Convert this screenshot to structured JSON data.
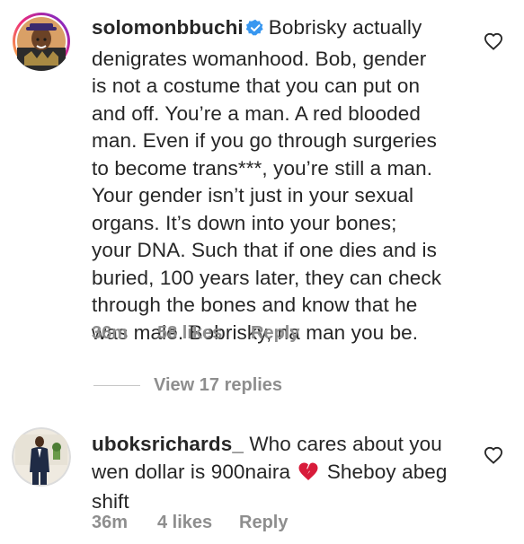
{
  "comments": [
    {
      "username": "solomonbbuchi",
      "verified": true,
      "text_lines": [
        "Bobrisky actually",
        "denigrates womanhood. Bob, gender",
        "is not a costume that you can put on",
        "and off. You’re a man. A red blooded",
        "man. Even if you go through surgeries",
        "to become trans***, you’re still a man.",
        "Your gender isn’t just in your sexual",
        "organs. It’s down into your bones;",
        "your DNA. Such that if one dies and is",
        "buried, 100 years later, they can check",
        "through the bones and know that he",
        "was male. Bobrisky, na man you be."
      ],
      "time": "36m",
      "likes": "58 likes",
      "reply_label": "Reply"
    },
    {
      "username": "uboksrichards_",
      "verified": false,
      "text_line1": "Who cares about you",
      "text_line2a": "wen dollar is 900naira",
      "emoji": "broken-heart-icon",
      "text_line2b": "Sheboy abeg",
      "text_line3": "shift",
      "time": "36m",
      "likes": "4 likes",
      "reply_label": "Reply"
    }
  ],
  "view_replies": "View 17 replies",
  "colors": {
    "text": "#262626",
    "meta": "#8e8e8e",
    "verified_blue": "#3897f0",
    "broken_heart": "#d81b3a"
  }
}
